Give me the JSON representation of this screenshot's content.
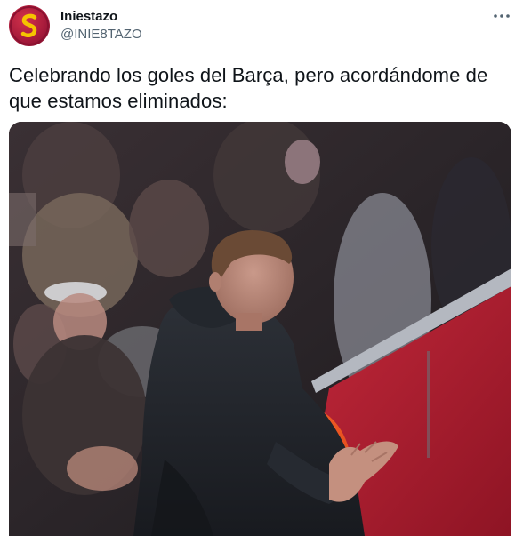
{
  "tweet": {
    "author_name": "Iniestazo",
    "author_handle": "@INIE8TAZO",
    "text": "Celebrando los goles del Barça, pero acordándome de que estamos eliminados:",
    "avatar_icon": "avatar-s-logo-icon",
    "more_icon": "more-options-icon",
    "media_kind": "video-frame"
  },
  "colors": {
    "text_primary": "#0f1419",
    "text_secondary": "#536471",
    "avatar_bg": "#a3193a",
    "avatar_logo": "#f5c400"
  }
}
